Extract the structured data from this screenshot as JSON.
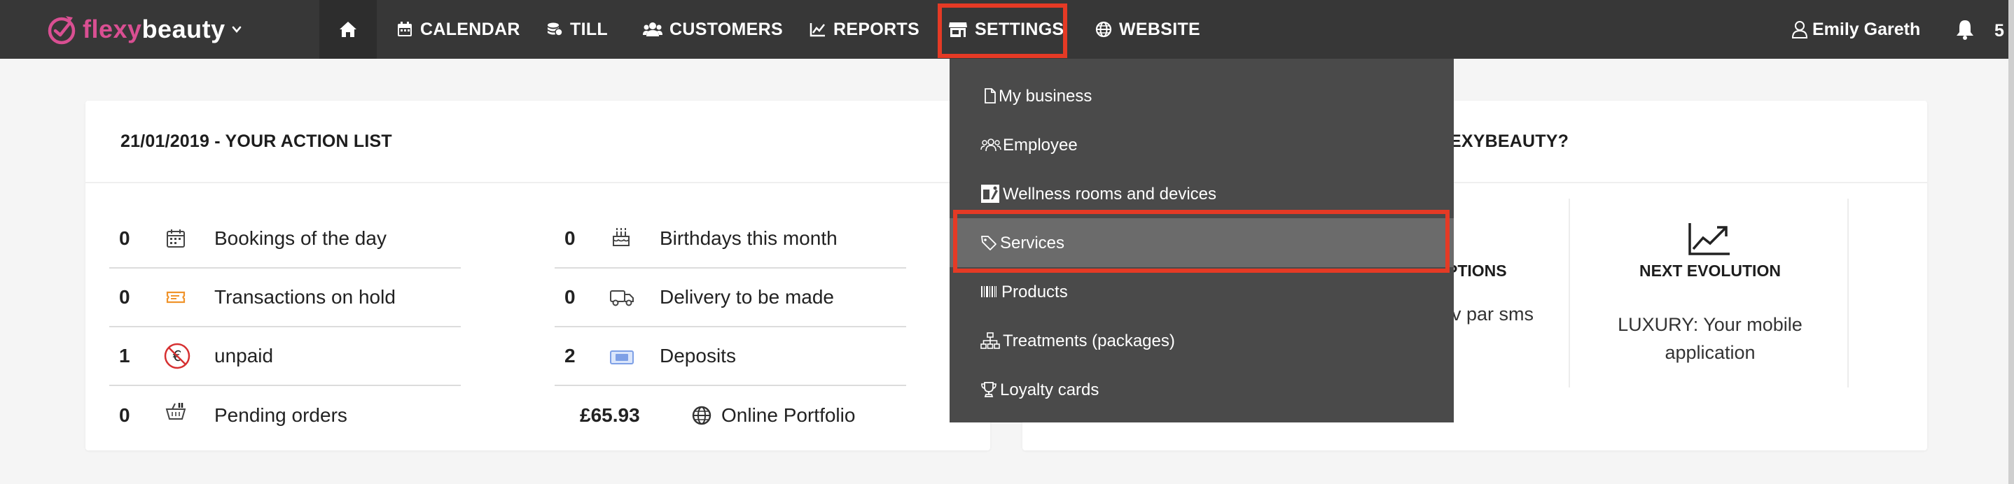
{
  "brand": {
    "part1": "flexy",
    "part2": "beauty",
    "accent": "#d94f92"
  },
  "nav": {
    "home_icon": "home-icon",
    "items": [
      {
        "label": "CALENDAR",
        "icon": "calendar-icon"
      },
      {
        "label": "TILL",
        "icon": "coins-icon"
      },
      {
        "label": "CUSTOMERS",
        "icon": "users-icon"
      },
      {
        "label": "REPORTS",
        "icon": "chart-icon"
      },
      {
        "label": "SETTINGS",
        "icon": "store-icon",
        "highlighted": true
      },
      {
        "label": "WEBSITE",
        "icon": "globe-icon"
      }
    ],
    "user_name": "Emily Gareth",
    "notification_count": "5"
  },
  "action_list": {
    "title": "21/01/2019 - YOUR ACTION LIST",
    "left_rows": [
      {
        "count": "0",
        "label": "Bookings of the day",
        "icon": "calendar-icon"
      },
      {
        "count": "0",
        "label": "Transactions on hold",
        "icon": "ticket-icon"
      },
      {
        "count": "1",
        "label": "unpaid",
        "icon": "no-euro-icon"
      },
      {
        "count": "0",
        "label": "Pending orders",
        "icon": "basket-icon"
      }
    ],
    "right_rows": [
      {
        "count": "0",
        "label": "Birthdays this month",
        "icon": "cake-icon"
      },
      {
        "count": "0",
        "label": "Delivery to be made",
        "icon": "truck-icon"
      },
      {
        "count": "2",
        "label": "Deposits",
        "icon": "banknote-icon"
      },
      {
        "count": "£65.93",
        "label": "Online Portfolio",
        "icon": "globe-icon"
      }
    ]
  },
  "right_card": {
    "title_partial": "EXYBEAUTY?",
    "options_partial": "PTIONS",
    "sms_partial": "dv par sms",
    "evolution_title": "NEXT EVOLUTION",
    "evolution_text": "LUXURY: Your mobile application"
  },
  "settings_menu": {
    "items": [
      {
        "label": "My business",
        "icon": "document-icon"
      },
      {
        "label": "Employee",
        "icon": "users-icon"
      },
      {
        "label": "Wellness rooms and devices",
        "icon": "room-icon"
      },
      {
        "label": "Services",
        "icon": "tag-icon",
        "highlighted": true
      },
      {
        "label": "Products",
        "icon": "barcode-icon"
      },
      {
        "label": "Treatments (packages)",
        "icon": "hierarchy-icon"
      },
      {
        "label": "Loyalty cards",
        "icon": "trophy-icon"
      }
    ]
  },
  "colors": {
    "topbar": "#373737",
    "highlight": "#e53a25",
    "dropdown": "#4a4a4a"
  }
}
